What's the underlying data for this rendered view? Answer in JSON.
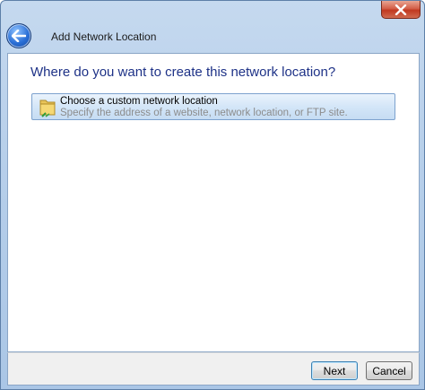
{
  "window": {
    "title": "Add Network Location",
    "close_icon": "close-icon"
  },
  "header": {
    "back_icon": "back-arrow-icon",
    "title": "Add Network Location"
  },
  "main": {
    "question": "Where do you want to create this network location?",
    "options": [
      {
        "icon": "folder-network-icon",
        "title": "Choose a custom network location",
        "description": "Specify the address of a website, network location, or FTP site.",
        "selected": true
      }
    ]
  },
  "footer": {
    "next_label": "Next",
    "cancel_label": "Cancel"
  },
  "colors": {
    "question_text": "#1e3287",
    "selection_border": "#7da2ce",
    "close_button": "#c0381f"
  }
}
